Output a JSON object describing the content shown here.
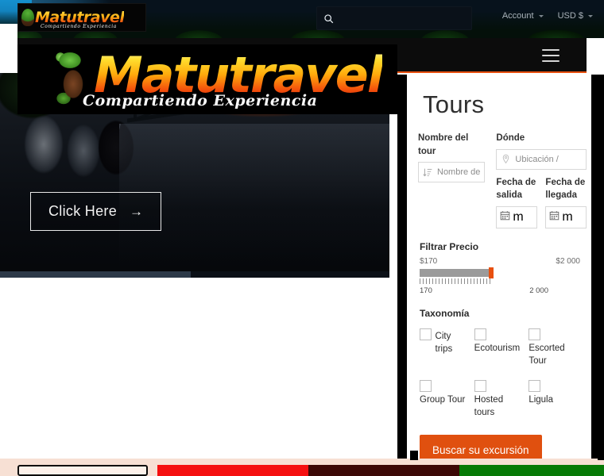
{
  "brand": {
    "name": "Matutravel",
    "tagline": "Compartiendo  Experiencia"
  },
  "topbar": {
    "search": {
      "placeholder": "",
      "value": "",
      "icon": "search-icon"
    },
    "account": {
      "label": "Account",
      "icon": "chevron-down-icon"
    },
    "currency": {
      "label": "USD $",
      "icon": "chevron-down-icon"
    }
  },
  "nav": {
    "menu_icon": "hamburger-menu-icon"
  },
  "hero": {
    "cta_label": "Click Here",
    "cta_arrow": "→"
  },
  "panel": {
    "title": "Tours",
    "tour_name": {
      "label": "Nombre del tour",
      "placeholder": "Nombre de",
      "value": "",
      "icon": "sort-icon"
    },
    "where": {
      "label": "Dónde",
      "placeholder": "Ubicación /",
      "value": "",
      "icon": "map-pin-icon"
    },
    "date_from": {
      "label": "Fecha de salida",
      "placeholder": "m",
      "value": "",
      "icon": "calendar-icon"
    },
    "date_to": {
      "label": "Fecha de llegada",
      "placeholder": "m",
      "value": "",
      "icon": "calendar-icon"
    },
    "price": {
      "title": "Filtrar Precio",
      "min_display": "$170",
      "max_display": "$2 000",
      "scale_min": "170",
      "scale_max": "2 000",
      "handle_color": "#e8500f"
    },
    "taxonomy": {
      "title": "Taxonomía",
      "options": [
        {
          "label": "City trips",
          "checked": false
        },
        {
          "label": "Ecotourism",
          "checked": false
        },
        {
          "label": "Escorted Tour",
          "checked": false
        },
        {
          "label": "Group Tour",
          "checked": false
        },
        {
          "label": "Hosted tours",
          "checked": false
        },
        {
          "label": "Ligula",
          "checked": false
        }
      ]
    },
    "submit_label": "Buscar su excursión",
    "accent_color": "#e0500f"
  },
  "colors": {
    "accent": "#e8500f",
    "bottom_bg": "#f7e0d4",
    "block_red": "#f51010",
    "block_dark": "#3c0806",
    "block_green": "#067a06"
  }
}
